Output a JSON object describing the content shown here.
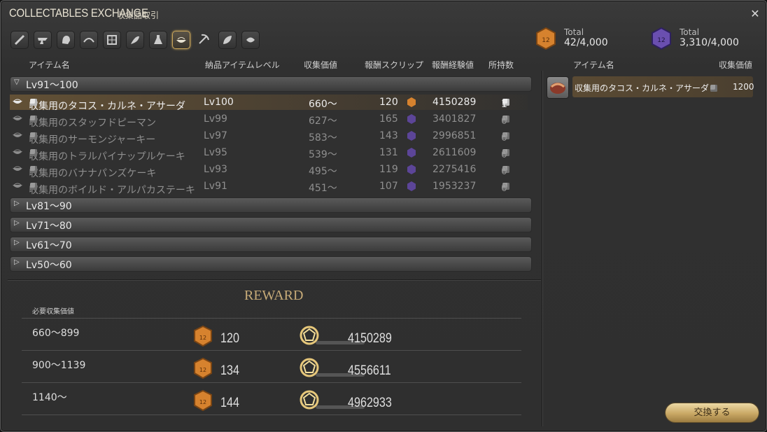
{
  "window": {
    "title": "COLLECTABLES EXCHANGE",
    "subtitle": "収集品取引",
    "close_icon": "close-x-icon"
  },
  "jobs": [
    "carpenter",
    "blacksmith",
    "armorer",
    "goldsmith",
    "leatherworker",
    "weaver",
    "alchemist",
    "culinarian",
    "miner",
    "botanist",
    "fisher"
  ],
  "selected_job": "culinarian",
  "scrips": [
    {
      "label": "Total",
      "value": "42/4,000",
      "color": "#d6822e"
    },
    {
      "label": "Total",
      "value": "3,310/4,000",
      "color": "#6a4fb0"
    }
  ],
  "table": {
    "headers": {
      "item": "アイテム名",
      "level": "納品アイテムレベル",
      "collectability": "収集価値",
      "reward_scrip": "報酬スクリップ",
      "reward_exp": "報酬経験値",
      "owned": "所持数"
    },
    "groups": [
      {
        "label": "Lv91～100",
        "expanded": true
      },
      {
        "label": "Lv81～90",
        "expanded": false
      },
      {
        "label": "Lv71～80",
        "expanded": false
      },
      {
        "label": "Lv61～70",
        "expanded": false
      },
      {
        "label": "Lv50～60",
        "expanded": false
      }
    ],
    "rows": [
      {
        "name": "収集用のタコス・カルネ・アサーダ",
        "level": "Lv100",
        "value": "660～",
        "scrip": "120",
        "scrip_type": "orange",
        "exp": "4150289",
        "owned": "1"
      },
      {
        "name": "収集用のスタッフドピーマン",
        "level": "Lv99",
        "value": "627～",
        "scrip": "165",
        "scrip_type": "purple",
        "exp": "3401827",
        "owned": "0"
      },
      {
        "name": "収集用のサーモンジャーキー",
        "level": "Lv97",
        "value": "583～",
        "scrip": "143",
        "scrip_type": "purple",
        "exp": "2996851",
        "owned": "0"
      },
      {
        "name": "収集用のトラルパイナップルケーキ",
        "level": "Lv95",
        "value": "539～",
        "scrip": "131",
        "scrip_type": "purple",
        "exp": "2611609",
        "owned": "0"
      },
      {
        "name": "収集用のバナナパンズケーキ",
        "level": "Lv93",
        "value": "495～",
        "scrip": "119",
        "scrip_type": "purple",
        "exp": "2275416",
        "owned": "0"
      },
      {
        "name": "収集用のボイルド・アルパカステーキ",
        "level": "Lv91",
        "value": "451～",
        "scrip": "107",
        "scrip_type": "purple",
        "exp": "1953237",
        "owned": "0"
      }
    ]
  },
  "reward": {
    "title": "REWARD",
    "required_label": "必要収集価値",
    "tiers": [
      {
        "range": "660～899",
        "scrip": "120",
        "exp": "4150289"
      },
      {
        "range": "900～1139",
        "scrip": "134",
        "exp": "4556611"
      },
      {
        "range": "1140～",
        "scrip": "144",
        "exp": "4962933"
      }
    ]
  },
  "inventory": {
    "headers": {
      "item": "アイテム名",
      "value": "収集価値"
    },
    "items": [
      {
        "name": "収集用のタコス・カルネ・アサーダ",
        "value": "1200"
      }
    ]
  },
  "exchange_button": "交換する"
}
